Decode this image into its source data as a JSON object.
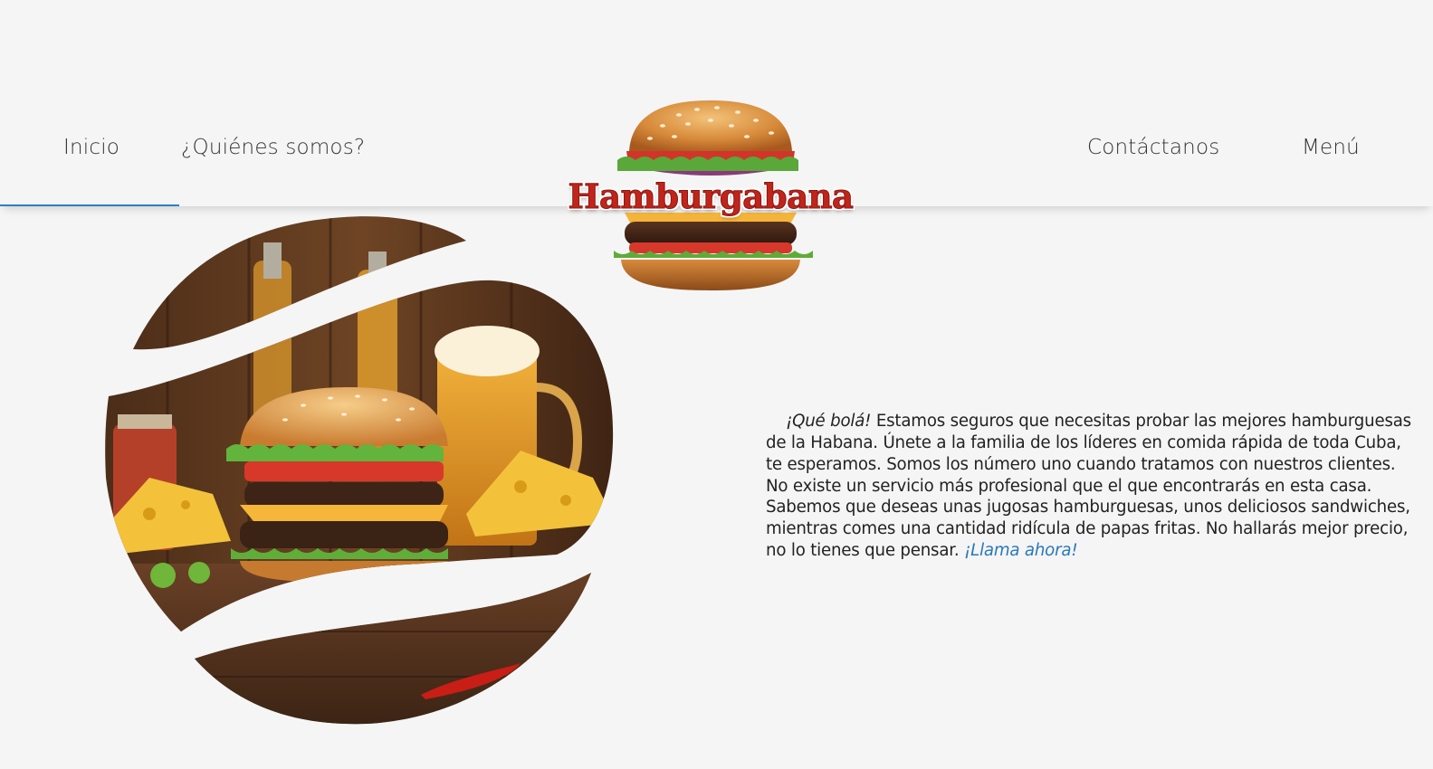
{
  "nav": {
    "home": "Inicio",
    "about": "¿Quiénes somos?",
    "contact": "Contáctanos",
    "menu": "Menú",
    "active": "home"
  },
  "brand": {
    "name": "Hamburgabana",
    "logo_icon": "burger-logo-icon"
  },
  "hero": {
    "image": "burger-beer-cheese-photo"
  },
  "intro": {
    "greeting": "¡Qué bolá!",
    "body": " Estamos seguros que necesitas probar las mejores hamburguesas de la Habana. Únete a la familia de los líderes en comida rápida de toda Cuba, te esperamos. Somos los número uno cuando tratamos con nuestros clientes. No existe un servicio más profesional que el que encontrarás en esta casa. Sabemos que deseas unas jugosas hamburguesas, unos deliciosos sandwiches, mientras comes una cantidad ridícula de papas fritas. No hallarás mejor precio, no lo tienes que pensar. ",
    "cta": "¡Llama ahora!"
  },
  "colors": {
    "accent": "#2f7fc4",
    "brand_red": "#c0241a",
    "background": "#f5f5f5",
    "text": "#222222"
  }
}
